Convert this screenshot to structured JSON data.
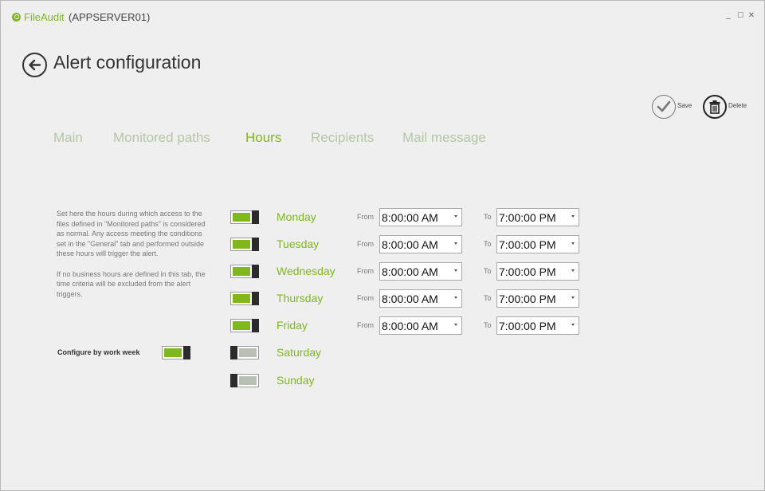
{
  "app": {
    "name": "FileAudit",
    "server": "(APPSERVER01)",
    "controls": {
      "minimize": "_",
      "maximize": "☐",
      "close": "✕"
    }
  },
  "header": {
    "title": "Alert configuration"
  },
  "actions": {
    "save_label": "Save",
    "delete_label": "Delete"
  },
  "tabs": [
    {
      "label": "Main",
      "active": false
    },
    {
      "label": "Monitored paths",
      "active": false
    },
    {
      "label": "Hours",
      "active": true
    },
    {
      "label": "Recipients",
      "active": false
    },
    {
      "label": "Mail message",
      "active": false
    }
  ],
  "description": {
    "paragraph1": "Set here the hours during which access to the files defined in \"Monitored paths\" is considered as normal. Any access meeting the conditions set in the \"General\" tab and performed outside these hours will trigger the alert.",
    "paragraph2": "If no business hours are defined in this tab, the time criteria will be excluded from the alert triggers."
  },
  "work_week": {
    "label": "Configure by work week",
    "enabled": true
  },
  "labels": {
    "from": "From",
    "to": "To"
  },
  "days": [
    {
      "name": "Monday",
      "enabled": true,
      "from": "8:00:00 AM",
      "to": "7:00:00 PM"
    },
    {
      "name": "Tuesday",
      "enabled": true,
      "from": "8:00:00 AM",
      "to": "7:00:00 PM"
    },
    {
      "name": "Wednesday",
      "enabled": true,
      "from": "8:00:00 AM",
      "to": "7:00:00 PM"
    },
    {
      "name": "Thursday",
      "enabled": true,
      "from": "8:00:00 AM",
      "to": "7:00:00 PM"
    },
    {
      "name": "Friday",
      "enabled": true,
      "from": "8:00:00 AM",
      "to": "7:00:00 PM"
    },
    {
      "name": "Saturday",
      "enabled": false
    },
    {
      "name": "Sunday",
      "enabled": false
    }
  ],
  "colors": {
    "accent": "#7fb71c",
    "tab_inactive": "#b7c6a5",
    "background": "#efefef"
  },
  "icons": {
    "logo": "fileaudit-logo-icon",
    "back": "back-arrow-icon",
    "save": "checkmark-icon",
    "delete": "trash-icon"
  }
}
